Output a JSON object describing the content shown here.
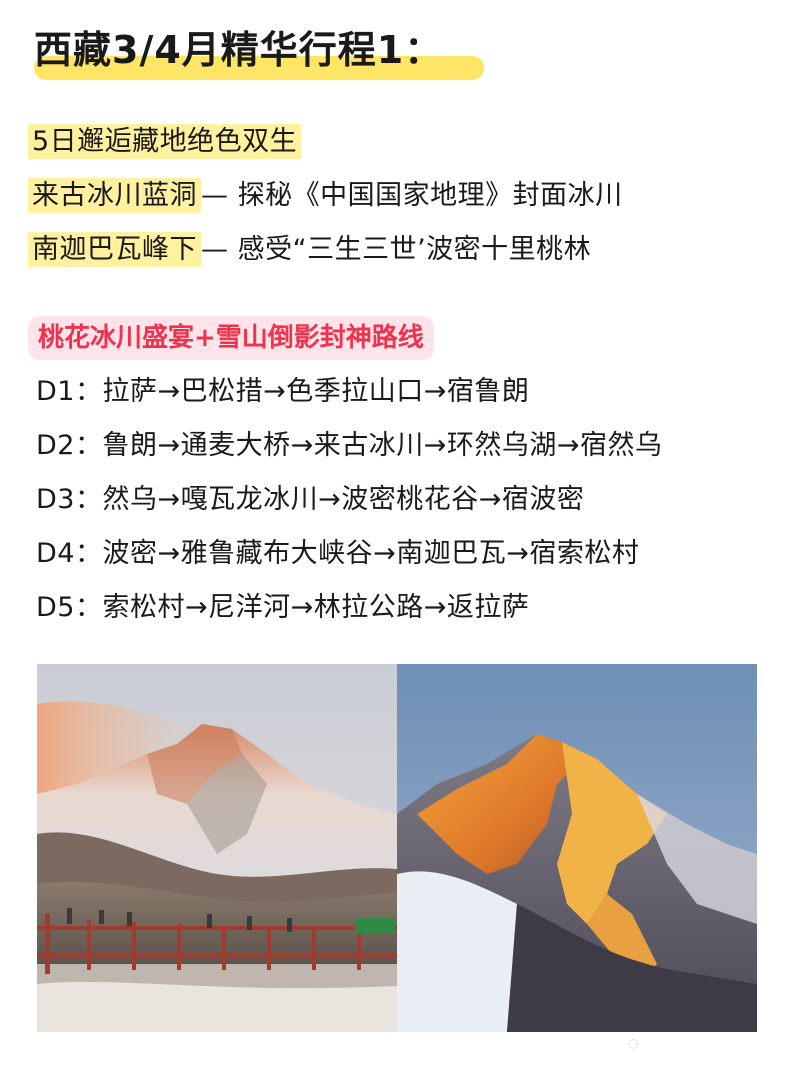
{
  "title": "西藏3/4月精华行程1：",
  "intro": {
    "headline": "5日邂逅藏地绝色双生",
    "line1_highlight": "来古冰川蓝洞",
    "line1_rest": "— 探秘《中国国家地理》封面冰川",
    "line2_highlight": "南迦巴瓦峰下",
    "line2_rest": "— 感受“三生三世’波密十里桃林"
  },
  "route": {
    "title": "桃花冰川盛宴+雪山倒影封神路线",
    "days": [
      {
        "label": "D1：",
        "text": "拉萨→巴松措→色季拉山口→宿鲁朗"
      },
      {
        "label": "D2：",
        "text": "鲁朗→通麦大桥→来古冰川→环然乌湖→宿然乌"
      },
      {
        "label": "D3：",
        "text": "然乌→嘎瓦龙冰川→波密桃花谷→宿波密"
      },
      {
        "label": "D4：",
        "text": "波密→雅鲁藏布大峡谷→南迦巴瓦→宿索松村"
      },
      {
        "label": "D5：",
        "text": "索松村→尼洋河→林拉公路→返拉萨"
      }
    ]
  },
  "colors": {
    "title_highlight": "#ffe565",
    "text_highlight": "#fff1a0",
    "route_title_bg": "#ffe4ea",
    "route_title_text": "#f0324e"
  }
}
